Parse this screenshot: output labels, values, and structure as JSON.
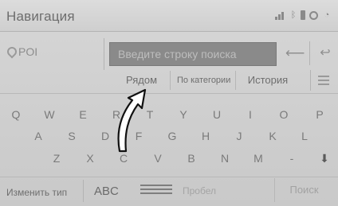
{
  "header": {
    "title": "Навигация",
    "status_icons": [
      "signal-icon",
      "bluetooth-icon",
      "settings-icon",
      "wifi-icon"
    ]
  },
  "search": {
    "category_label": "POI",
    "placeholder": "Введите строку поиска",
    "value": ""
  },
  "tabs": [
    {
      "label": "Рядом"
    },
    {
      "label": "По категории"
    },
    {
      "label": "История"
    }
  ],
  "keyboard": {
    "rows": [
      [
        "Q",
        "W",
        "E",
        "R",
        "T",
        "Y",
        "U",
        "I",
        "O",
        "P"
      ],
      [
        "A",
        "S",
        "D",
        "F",
        "G",
        "H",
        "J",
        "K",
        "L"
      ],
      [
        "Z",
        "X",
        "C",
        "V",
        "B",
        "N",
        "M",
        "-",
        "⬇"
      ]
    ]
  },
  "bottom": {
    "change_type": "Изменить тип",
    "abc": "ABC",
    "space": "Пробел",
    "search": "Поиск"
  },
  "colors": {
    "background": "#cfcfcf",
    "search_field": "#8a8a8a",
    "annotation_arrow": "#111111"
  }
}
